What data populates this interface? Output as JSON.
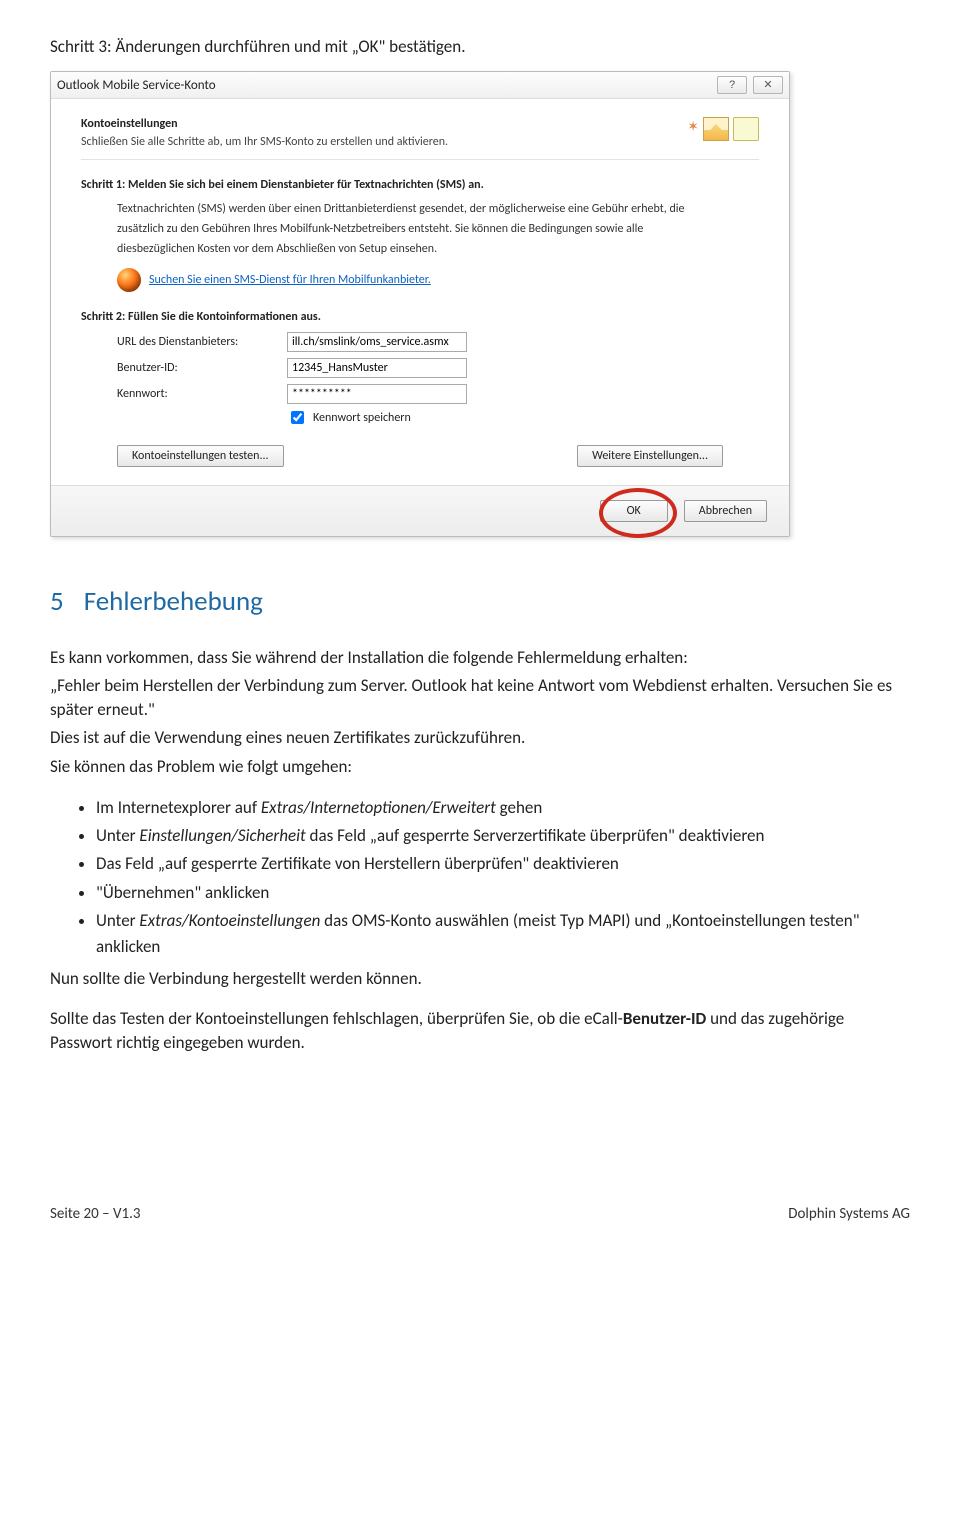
{
  "doc": {
    "step3": "Schritt 3: Änderungen durchführen und mit „OK\" bestätigen.",
    "section5_num": "5",
    "section5_title": "Fehlerbehebung",
    "para1": "Es kann vorkommen, dass Sie während der Installation die folgende Fehlermeldung erhalten:",
    "para2": "„Fehler beim Herstellen der Verbindung zum Server. Outlook hat keine Antwort vom Webdienst erhalten. Versuchen Sie es später erneut.\"",
    "para3": "Dies ist auf die Verwendung eines neuen Zertifikates zurückzuführen.",
    "para4": "Sie können das Problem wie folgt umgehen:",
    "bullets": [
      "Im Internetexplorer auf <i>Extras/Internetoptionen/Erweitert</i> gehen",
      "Unter <i>Einstellungen/Sicherheit</i> das Feld „auf gesperrte Serverzertifikate überprüfen\" deaktivieren",
      "Das Feld „auf gesperrte Zertifikate von Herstellern überprüfen\" deaktivieren",
      "\"Übernehmen\" anklicken",
      "Unter <i>Extras/Kontoeinstellungen</i> das OMS-Konto auswählen (meist Typ MAPI) und „Kontoeinstellungen testen\" anklicken"
    ],
    "para5": "Nun sollte die Verbindung hergestellt werden können.",
    "para6a": "Sollte das Testen der Kontoeinstellungen fehlschlagen, überprüfen Sie, ob die eCall-",
    "para6b": "Benutzer-ID",
    "para6c": " und das zugehörige Passwort richtig eingegeben wurden.",
    "footer_left": "Seite 20 – V1.3",
    "footer_right": "Dolphin Systems AG"
  },
  "dialog": {
    "title": "Outlook Mobile Service-Konto",
    "banner_h": "Kontoeinstellungen",
    "banner_p": "Schließen Sie alle Schritte ab, um Ihr SMS-Konto zu erstellen und aktivieren.",
    "s1_h": "Schritt 1: Melden Sie sich bei einem Dienstanbieter für Textnachrichten (SMS) an.",
    "s1_p1": "Textnachrichten (SMS) werden über einen Drittanbieterdienst gesendet, der möglicherweise eine Gebühr erhebt, die",
    "s1_p2": "zusätzlich zu den Gebühren Ihres Mobilfunk-Netzbetreibers entsteht. Sie können die Bedingungen sowie alle",
    "s1_p3": "diesbezüglichen Kosten vor dem Abschließen von Setup einsehen.",
    "s1_link": "Suchen Sie einen SMS-Dienst für Ihren Mobilfunkanbieter.",
    "s2_h": "Schritt 2: Füllen Sie die Kontoinformationen aus.",
    "lbl_url": "URL des Dienstanbieters:",
    "val_url": "ill.ch/smslink/oms_service.asmx",
    "lbl_user": "Benutzer-ID:",
    "val_user": "12345_HansMuster",
    "lbl_pass": "Kennwort:",
    "val_pass": "**********",
    "chk_save": "Kennwort speichern",
    "btn_test": "Kontoeinstellungen testen...",
    "btn_more": "Weitere Einstellungen...",
    "btn_ok": "OK",
    "btn_cancel": "Abbrechen",
    "tbtn_help": "?",
    "tbtn_close": "✕"
  }
}
